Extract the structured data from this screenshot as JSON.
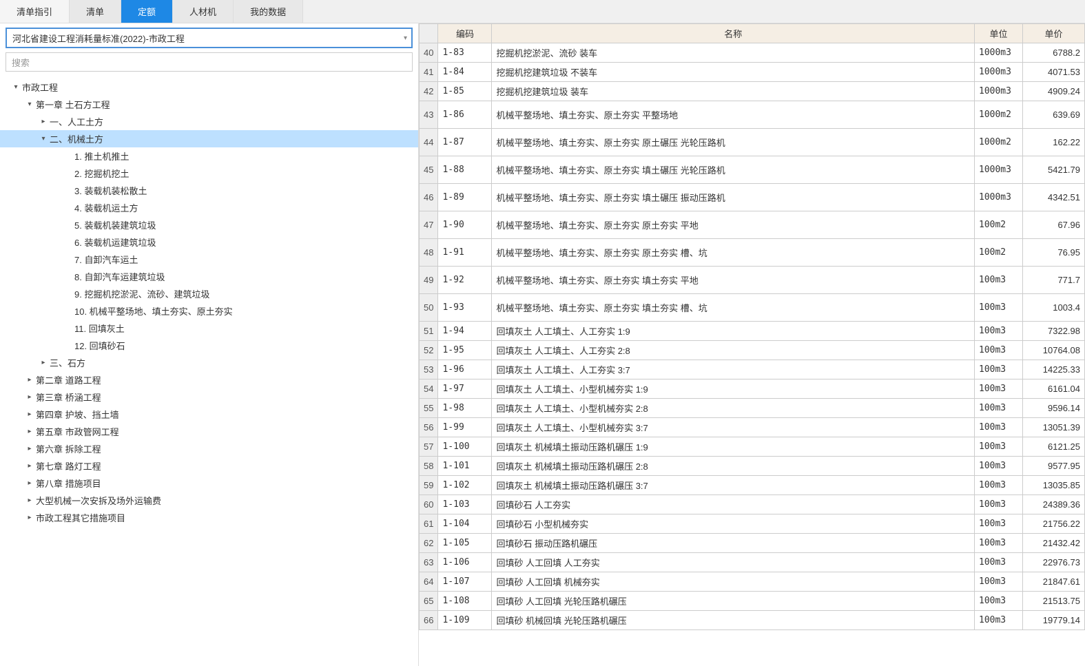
{
  "tabs": [
    {
      "label": "清单指引",
      "active": false
    },
    {
      "label": "清单",
      "active": false
    },
    {
      "label": "定额",
      "active": true
    },
    {
      "label": "人材机",
      "active": false
    },
    {
      "label": "我的数据",
      "active": false
    }
  ],
  "standard_select": "河北省建设工程消耗量标准(2022)-市政工程",
  "search_placeholder": "搜索",
  "tree": [
    {
      "indent": 0,
      "toggle": "▾",
      "label": "市政工程",
      "selected": false
    },
    {
      "indent": 1,
      "toggle": "▾",
      "label": "第一章 土石方工程",
      "selected": false
    },
    {
      "indent": 2,
      "toggle": "▸",
      "label": "一、人工土方",
      "selected": false
    },
    {
      "indent": 2,
      "toggle": "▾",
      "label": "二、机械土方",
      "selected": true
    },
    {
      "indent": 3,
      "toggle": "",
      "label": "1. 推土机推土",
      "selected": false
    },
    {
      "indent": 3,
      "toggle": "",
      "label": "2. 挖掘机挖土",
      "selected": false
    },
    {
      "indent": 3,
      "toggle": "",
      "label": "3. 装载机装松散土",
      "selected": false
    },
    {
      "indent": 3,
      "toggle": "",
      "label": "4. 装载机运土方",
      "selected": false
    },
    {
      "indent": 3,
      "toggle": "",
      "label": "5. 装载机装建筑垃圾",
      "selected": false
    },
    {
      "indent": 3,
      "toggle": "",
      "label": "6. 装载机运建筑垃圾",
      "selected": false
    },
    {
      "indent": 3,
      "toggle": "",
      "label": "7. 自卸汽车运土",
      "selected": false
    },
    {
      "indent": 3,
      "toggle": "",
      "label": "8. 自卸汽车运建筑垃圾",
      "selected": false
    },
    {
      "indent": 3,
      "toggle": "",
      "label": "9. 挖掘机挖淤泥、流砂、建筑垃圾",
      "selected": false
    },
    {
      "indent": 3,
      "toggle": "",
      "label": "10. 机械平整场地、填土夯实、原土夯实",
      "selected": false
    },
    {
      "indent": 3,
      "toggle": "",
      "label": "11. 回填灰土",
      "selected": false
    },
    {
      "indent": 3,
      "toggle": "",
      "label": "12. 回填砂石",
      "selected": false
    },
    {
      "indent": 2,
      "toggle": "▸",
      "label": "三、石方",
      "selected": false
    },
    {
      "indent": 1,
      "toggle": "▸",
      "label": "第二章 道路工程",
      "selected": false
    },
    {
      "indent": 1,
      "toggle": "▸",
      "label": "第三章 桥涵工程",
      "selected": false
    },
    {
      "indent": 1,
      "toggle": "▸",
      "label": "第四章 护坡、挡土墙",
      "selected": false
    },
    {
      "indent": 1,
      "toggle": "▸",
      "label": "第五章 市政管网工程",
      "selected": false
    },
    {
      "indent": 1,
      "toggle": "▸",
      "label": "第六章 拆除工程",
      "selected": false
    },
    {
      "indent": 1,
      "toggle": "▸",
      "label": "第七章 路灯工程",
      "selected": false
    },
    {
      "indent": 1,
      "toggle": "▸",
      "label": "第八章 措施项目",
      "selected": false
    },
    {
      "indent": 1,
      "toggle": "▸",
      "label": "大型机械一次安拆及场外运输费",
      "selected": false
    },
    {
      "indent": 1,
      "toggle": "▸",
      "label": "市政工程其它措施项目",
      "selected": false
    }
  ],
  "grid": {
    "headers": {
      "code": "编码",
      "name": "名称",
      "unit": "单位",
      "price": "单价"
    },
    "rows": [
      {
        "n": 40,
        "code": "1-83",
        "name": "挖掘机挖淤泥、流砂 装车",
        "unit": "1000m3",
        "price": "6788.2",
        "tall": false
      },
      {
        "n": 41,
        "code": "1-84",
        "name": "挖掘机挖建筑垃圾 不装车",
        "unit": "1000m3",
        "price": "4071.53",
        "tall": false
      },
      {
        "n": 42,
        "code": "1-85",
        "name": "挖掘机挖建筑垃圾 装车",
        "unit": "1000m3",
        "price": "4909.24",
        "tall": false
      },
      {
        "n": 43,
        "code": "1-86",
        "name": "机械平整场地、填土夯实、原土夯实 平整场地",
        "unit": "1000m2",
        "price": "639.69",
        "tall": true
      },
      {
        "n": 44,
        "code": "1-87",
        "name": "机械平整场地、填土夯实、原土夯实 原土碾压 光轮压路机",
        "unit": "1000m2",
        "price": "162.22",
        "tall": true
      },
      {
        "n": 45,
        "code": "1-88",
        "name": "机械平整场地、填土夯实、原土夯实 填土碾压 光轮压路机",
        "unit": "1000m3",
        "price": "5421.79",
        "tall": true
      },
      {
        "n": 46,
        "code": "1-89",
        "name": "机械平整场地、填土夯实、原土夯实 填土碾压 振动压路机",
        "unit": "1000m3",
        "price": "4342.51",
        "tall": true
      },
      {
        "n": 47,
        "code": "1-90",
        "name": "机械平整场地、填土夯实、原土夯实 原土夯实 平地",
        "unit": "100m2",
        "price": "67.96",
        "tall": true
      },
      {
        "n": 48,
        "code": "1-91",
        "name": "机械平整场地、填土夯实、原土夯实 原土夯实 槽、坑",
        "unit": "100m2",
        "price": "76.95",
        "tall": true
      },
      {
        "n": 49,
        "code": "1-92",
        "name": "机械平整场地、填土夯实、原土夯实 填土夯实 平地",
        "unit": "100m3",
        "price": "771.7",
        "tall": true
      },
      {
        "n": 50,
        "code": "1-93",
        "name": "机械平整场地、填土夯实、原土夯实 填土夯实 槽、坑",
        "unit": "100m3",
        "price": "1003.4",
        "tall": true
      },
      {
        "n": 51,
        "code": "1-94",
        "name": "回填灰土 人工填土、人工夯实 1:9",
        "unit": "100m3",
        "price": "7322.98",
        "tall": false
      },
      {
        "n": 52,
        "code": "1-95",
        "name": "回填灰土 人工填土、人工夯实 2:8",
        "unit": "100m3",
        "price": "10764.08",
        "tall": false
      },
      {
        "n": 53,
        "code": "1-96",
        "name": "回填灰土 人工填土、人工夯实 3:7",
        "unit": "100m3",
        "price": "14225.33",
        "tall": false
      },
      {
        "n": 54,
        "code": "1-97",
        "name": "回填灰土 人工填土、小型机械夯实 1:9",
        "unit": "100m3",
        "price": "6161.04",
        "tall": false
      },
      {
        "n": 55,
        "code": "1-98",
        "name": "回填灰土 人工填土、小型机械夯实 2:8",
        "unit": "100m3",
        "price": "9596.14",
        "tall": false
      },
      {
        "n": 56,
        "code": "1-99",
        "name": "回填灰土 人工填土、小型机械夯实 3:7",
        "unit": "100m3",
        "price": "13051.39",
        "tall": false
      },
      {
        "n": 57,
        "code": "1-100",
        "name": "回填灰土 机械填土振动压路机碾压 1:9",
        "unit": "100m3",
        "price": "6121.25",
        "tall": false
      },
      {
        "n": 58,
        "code": "1-101",
        "name": "回填灰土 机械填土振动压路机碾压 2:8",
        "unit": "100m3",
        "price": "9577.95",
        "tall": false
      },
      {
        "n": 59,
        "code": "1-102",
        "name": "回填灰土 机械填土振动压路机碾压 3:7",
        "unit": "100m3",
        "price": "13035.85",
        "tall": false
      },
      {
        "n": 60,
        "code": "1-103",
        "name": "回填砂石 人工夯实",
        "unit": "100m3",
        "price": "24389.36",
        "tall": false
      },
      {
        "n": 61,
        "code": "1-104",
        "name": "回填砂石 小型机械夯实",
        "unit": "100m3",
        "price": "21756.22",
        "tall": false
      },
      {
        "n": 62,
        "code": "1-105",
        "name": "回填砂石 振动压路机碾压",
        "unit": "100m3",
        "price": "21432.42",
        "tall": false
      },
      {
        "n": 63,
        "code": "1-106",
        "name": "回填砂 人工回填 人工夯实",
        "unit": "100m3",
        "price": "22976.73",
        "tall": false
      },
      {
        "n": 64,
        "code": "1-107",
        "name": "回填砂 人工回填 机械夯实",
        "unit": "100m3",
        "price": "21847.61",
        "tall": false
      },
      {
        "n": 65,
        "code": "1-108",
        "name": "回填砂 人工回填 光轮压路机碾压",
        "unit": "100m3",
        "price": "21513.75",
        "tall": false
      },
      {
        "n": 66,
        "code": "1-109",
        "name": "回填砂 机械回填 光轮压路机碾压",
        "unit": "100m3",
        "price": "19779.14",
        "tall": false
      }
    ]
  }
}
